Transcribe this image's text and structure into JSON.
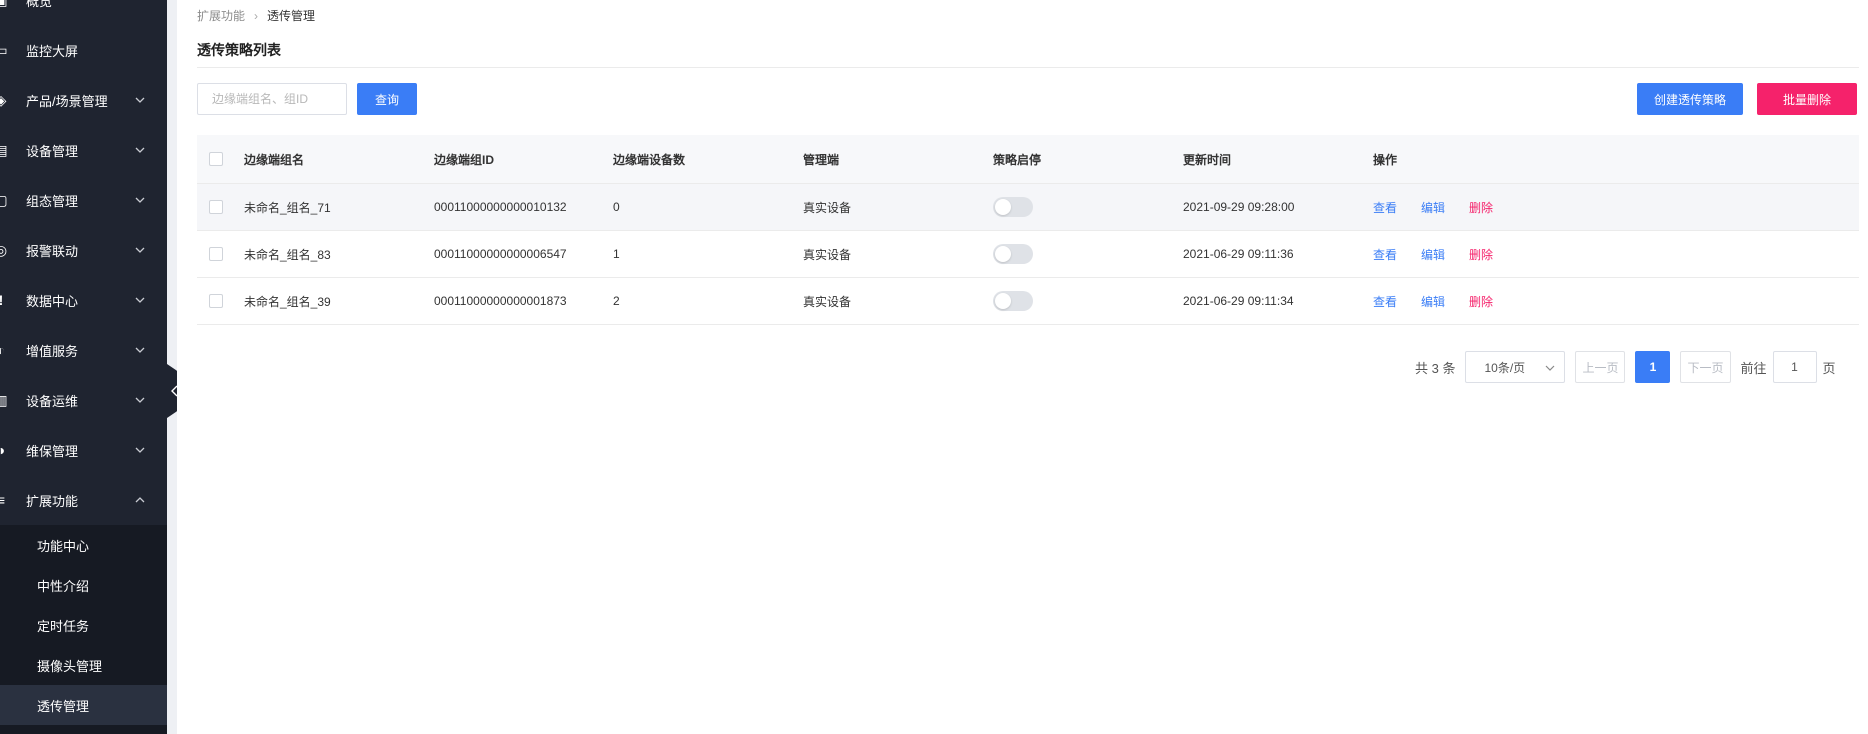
{
  "sidebar": {
    "items": [
      {
        "icon": "overview-icon",
        "glyph": "▣",
        "label": "概览",
        "chevron": "none"
      },
      {
        "icon": "monitor-icon",
        "glyph": "▭",
        "label": "监控大屏",
        "chevron": "none"
      },
      {
        "icon": "product-icon",
        "glyph": "◈",
        "label": "产品/场景管理",
        "chevron": "down"
      },
      {
        "icon": "device-icon",
        "glyph": "▤",
        "label": "设备管理",
        "chevron": "down"
      },
      {
        "icon": "config-icon",
        "glyph": "▢",
        "label": "组态管理",
        "chevron": "down"
      },
      {
        "icon": "alarm-icon",
        "glyph": "◎",
        "label": "报警联动",
        "chevron": "down"
      },
      {
        "icon": "data-icon",
        "glyph": "!",
        "label": "数据中心",
        "chevron": "down"
      },
      {
        "icon": "value-added-icon",
        "glyph": "◐",
        "label": "增值服务",
        "chevron": "down"
      },
      {
        "icon": "ops-icon",
        "glyph": "▥",
        "label": "设备运维",
        "chevron": "down"
      },
      {
        "icon": "maintenance-icon",
        "glyph": "◑",
        "label": "维保管理",
        "chevron": "down"
      },
      {
        "icon": "extension-icon",
        "glyph": "≡",
        "label": "扩展功能",
        "chevron": "up"
      }
    ],
    "sub_items": [
      {
        "label": "功能中心",
        "active": false
      },
      {
        "label": "中性介绍",
        "active": false
      },
      {
        "label": "定时任务",
        "active": false
      },
      {
        "label": "摄像头管理",
        "active": false
      },
      {
        "label": "透传管理",
        "active": true
      }
    ]
  },
  "breadcrumb": {
    "parent": "扩展功能",
    "separator": "›",
    "current": "透传管理"
  },
  "page": {
    "title": "透传策略列表"
  },
  "toolbar": {
    "search_placeholder": "边缘端组名、组ID",
    "search_value": "",
    "query_label": "查询",
    "create_label": "创建透传策略",
    "batch_delete_label": "批量删除"
  },
  "table": {
    "headers": [
      "边缘端组名",
      "边缘端组ID",
      "边缘端设备数",
      "管理端",
      "策略启停",
      "更新时间",
      "操作"
    ],
    "rows": [
      {
        "name": "未命名_组名_71",
        "id": "00011000000000010132",
        "count": "0",
        "manager": "真实设备",
        "enabled": false,
        "updated": "2021-09-29 09:28:00"
      },
      {
        "name": "未命名_组名_83",
        "id": "00011000000000006547",
        "count": "1",
        "manager": "真实设备",
        "enabled": false,
        "updated": "2021-06-29 09:11:36"
      },
      {
        "name": "未命名_组名_39",
        "id": "00011000000000001873",
        "count": "2",
        "manager": "真实设备",
        "enabled": false,
        "updated": "2021-06-29 09:11:34"
      }
    ],
    "actions": {
      "view": "查看",
      "edit": "编辑",
      "delete": "删除"
    }
  },
  "pagination": {
    "total_text": "共 3 条",
    "page_size": "10条/页",
    "prev_label": "上一页",
    "current_page": "1",
    "next_label": "下一页",
    "goto_label": "前往",
    "goto_value": "1",
    "goto_unit": "页"
  },
  "colors": {
    "sidebar_bg": "#1f2430",
    "submenu_bg": "#161a23",
    "primary": "#3a7df6",
    "danger": "#f5226b"
  }
}
